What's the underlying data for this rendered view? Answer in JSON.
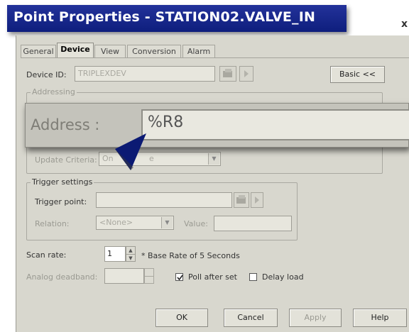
{
  "title": "Point Properties - STATION02.VALVE_IN",
  "tabs": [
    "General",
    "Device",
    "View",
    "Conversion",
    "Alarm"
  ],
  "device": {
    "device_id_label": "Device ID:",
    "device_id_value": "TRIPLEXDEV",
    "basic_button": "Basic <<"
  },
  "addressing": {
    "group_label": "Addressing",
    "address_label": "Address :",
    "address_value": "%R8",
    "update_criteria_label": "Update Criteria:",
    "update_criteria_value": "On",
    "update_criteria_tail": "e"
  },
  "trigger": {
    "group_label": "Trigger settings",
    "trigger_point_label": "Trigger point:",
    "relation_label": "Relation:",
    "relation_value": "<None>",
    "value_label": "Value:"
  },
  "scan": {
    "scan_rate_label": "Scan rate:",
    "scan_rate_value": "1",
    "base_rate_note": "* Base Rate of 5 Seconds",
    "analog_deadband_label": "Analog deadband:",
    "poll_after_set_label": "Poll after set",
    "poll_after_set_checked": true,
    "delay_load_label": "Delay load",
    "delay_load_checked": false
  },
  "buttons": {
    "ok": "OK",
    "cancel": "Cancel",
    "apply": "Apply",
    "help": "Help"
  },
  "icons": {
    "close": "close-icon",
    "browse": "browse-icon",
    "arrow": "arrow-icon",
    "callout": "callout-pointer-icon"
  }
}
